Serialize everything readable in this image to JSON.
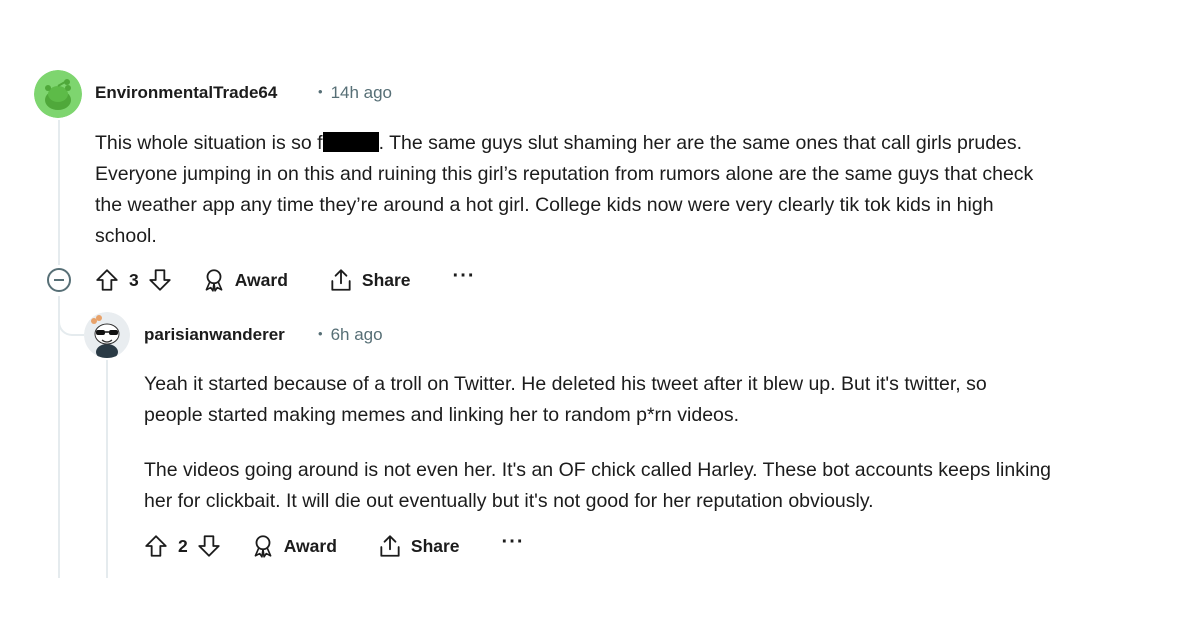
{
  "comment": {
    "username": "EnvironmentalTrade64",
    "time": "14h ago",
    "body_lines": [
      "This whole situation is so f",
      ". The same guys slut shaming her are the same ones that call girls prudes.",
      "Everyone jumping in on this and ruining this girl’s reputation from rumors alone are the same guys that check",
      "the weather app any time they’re around a hot girl. College kids now were very clearly tik tok kids in high",
      "school."
    ],
    "votes": "3",
    "award_label": "Award",
    "share_label": "Share",
    "more_label": "···",
    "avatar_color": "#7ed56f"
  },
  "reply": {
    "username": "parisianwanderer",
    "time": "6h ago",
    "paragraphs": [
      [
        "Yeah it started because of a troll on Twitter. He deleted his tweet after it blew up. But it's twitter, so",
        "people started making memes and linking her to random p*rn videos."
      ],
      [
        "The videos going around is not even her. It's an OF chick called Harley. These bot accounts keeps linking",
        "her for clickbait. It will die out eventually but it's not good for her reputation obviously."
      ]
    ],
    "votes": "2",
    "award_label": "Award",
    "share_label": "Share",
    "more_label": "···"
  },
  "separator": "•"
}
